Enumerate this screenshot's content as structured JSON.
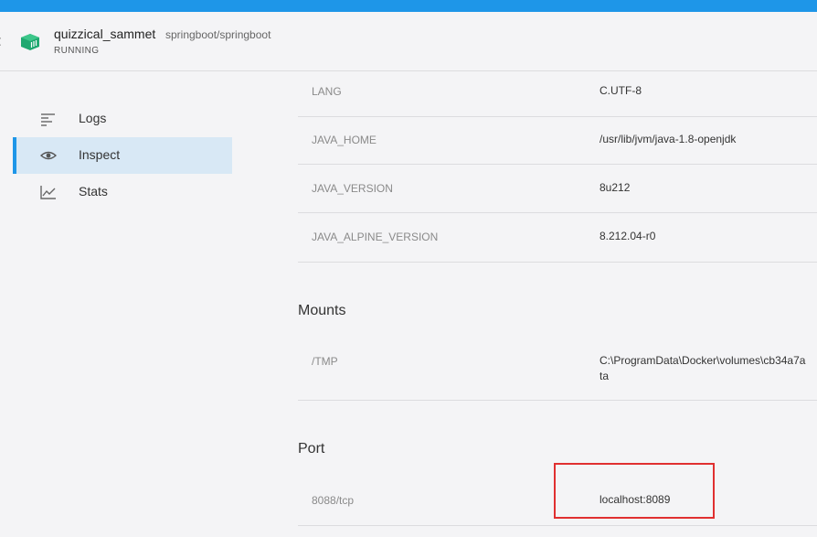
{
  "container": {
    "name": "quizzical_sammet",
    "image": "springboot/springboot",
    "status": "RUNNING",
    "brand_color": "#1fa870"
  },
  "nav": {
    "items": [
      {
        "label": "Logs",
        "icon": "logs-icon"
      },
      {
        "label": "Inspect",
        "icon": "eye-icon",
        "active": true
      },
      {
        "label": "Stats",
        "icon": "stats-chart-icon"
      }
    ]
  },
  "env": [
    {
      "key": "LANG",
      "value": "C.UTF-8"
    },
    {
      "key": "JAVA_HOME",
      "value": "/usr/lib/jvm/java-1.8-openjdk"
    },
    {
      "key": "JAVA_VERSION",
      "value": "8u212"
    },
    {
      "key": "JAVA_ALPINE_VERSION",
      "value": "8.212.04-r0"
    }
  ],
  "mounts": {
    "title": "Mounts",
    "items": [
      {
        "key": "/TMP",
        "value_line1": "C:\\ProgramData\\Docker\\volumes\\cb34a7a",
        "value_line2": "ta"
      }
    ]
  },
  "port": {
    "title": "Port",
    "items": [
      {
        "key": "8088/tcp",
        "value": "localhost:8089"
      }
    ]
  },
  "colors": {
    "accent": "#1e96e8",
    "highlight_border": "#e03030"
  }
}
